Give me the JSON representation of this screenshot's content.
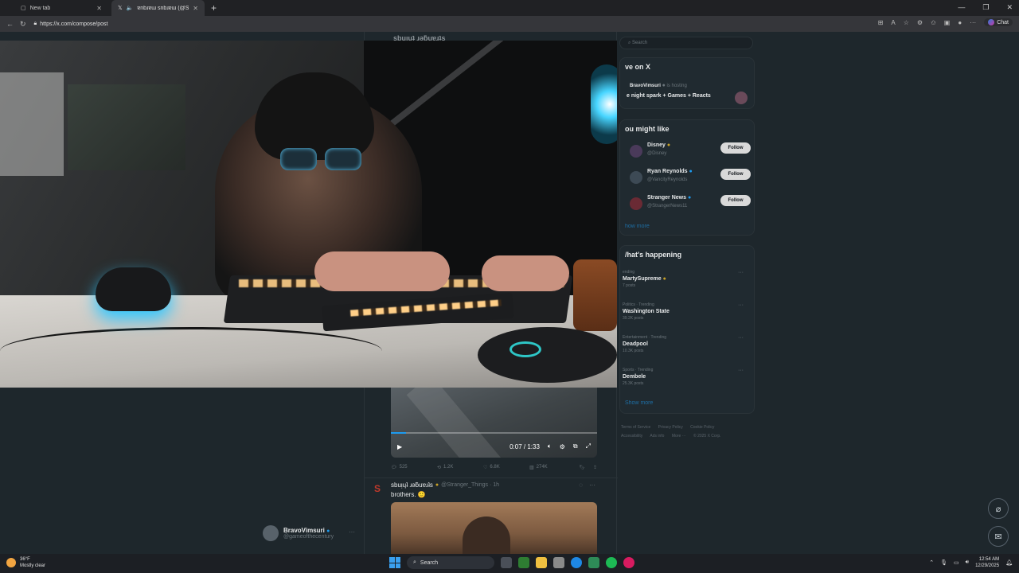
{
  "browser": {
    "tabs": [
      {
        "title": "New tab"
      },
      {
        "title": "ɐnbɹɐɯ snbɹɐɯ (@Stranger_Th"
      }
    ],
    "url": "https://x.com/compose/post",
    "chat_label": "Chat"
  },
  "center": {
    "header_name": "sbuᴉɥʇ ɹǝƃuɐɹʇs",
    "player": {
      "time": "0:07 / 1:33",
      "progress": 0.075
    },
    "actions": {
      "replies": "525",
      "reposts": "1.2K",
      "likes": "6.8K",
      "views": "274K"
    },
    "post2": {
      "name": "sbuᴉɥʇ ɹǝƃuɐɹʇs",
      "handle": "@Stranger_Things · 1h",
      "text": "brothers. 🙂"
    },
    "account": {
      "name": "BravoVimsuri",
      "handle": "@gameofthecentury"
    }
  },
  "sidebar": {
    "search_placeholder": "Search",
    "live": {
      "title": "ve on X",
      "host": "BravoVimsuri",
      "host_suffix": "is hosting",
      "space_title": "e night spark + Games + Reacts"
    },
    "who_to_follow": {
      "title": "ou might like",
      "users": [
        {
          "name": "Disney",
          "handle": "@Disney",
          "button": "Follow"
        },
        {
          "name": "Ryan Reynolds",
          "handle": "@VancityReynolds",
          "button": "Follow"
        },
        {
          "name": "Stranger News",
          "handle": "@StrangerNews11",
          "button": "Follow"
        }
      ],
      "show_more": "how more"
    },
    "happening": {
      "title": "/hat's happening",
      "trends": [
        {
          "context": "ending",
          "name": "MartySupreme",
          "posts": "7 posts"
        },
        {
          "context": "Politics · Trending",
          "name": "Washington State",
          "posts": "39.2K posts"
        },
        {
          "context": "Entertainment · Trending",
          "name": "Deadpool",
          "posts": "10.3K posts"
        },
        {
          "context": "Sports · Trending",
          "name": "Dembele",
          "posts": "25.3K posts"
        }
      ],
      "show_more": "Show more"
    },
    "footer": [
      "Terms of Service",
      "Privacy Policy",
      "Cookie Policy",
      "Accessibility",
      "Ads info",
      "More ···",
      "© 2025 X Corp."
    ]
  },
  "taskbar": {
    "weather_temp": "36°F",
    "weather_desc": "Mostly clear",
    "search_label": "Search",
    "time": "12:54 AM",
    "date": "12/29/2025"
  }
}
